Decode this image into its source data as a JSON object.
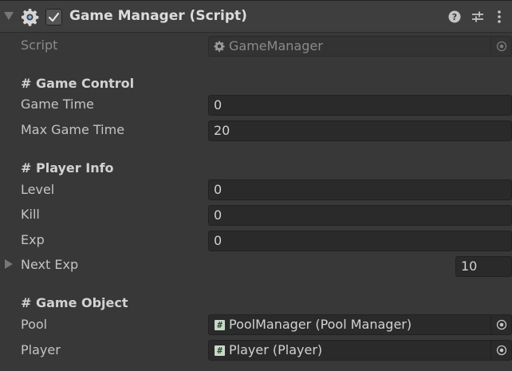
{
  "header": {
    "title": "Game Manager (Script)",
    "icons": [
      "foldout-arrow",
      "gear-icon",
      "enabled-checkbox",
      "help-icon",
      "presets-icon",
      "kebab-menu-icon"
    ]
  },
  "script_row": {
    "label": "Script",
    "value": "GameManager"
  },
  "game_control": {
    "heading": "# Game Control",
    "game_time_label": "Game Time",
    "game_time_value": "0",
    "max_game_time_label": "Max Game Time",
    "max_game_time_value": "20"
  },
  "player_info": {
    "heading": "# Player Info",
    "level_label": "Level",
    "level_value": "0",
    "kill_label": "Kill",
    "kill_value": "0",
    "exp_label": "Exp",
    "exp_value": "0",
    "next_exp_label": "Next Exp",
    "next_exp_size": "10"
  },
  "game_object": {
    "heading": "# Game Object",
    "pool_label": "Pool",
    "pool_value": "PoolManager (Pool Manager)",
    "player_label": "Player",
    "player_value": "Player (Player)"
  },
  "colors": {
    "background": "#383838",
    "header_background": "#3e3e3e",
    "field_background": "#2a2a2a"
  }
}
